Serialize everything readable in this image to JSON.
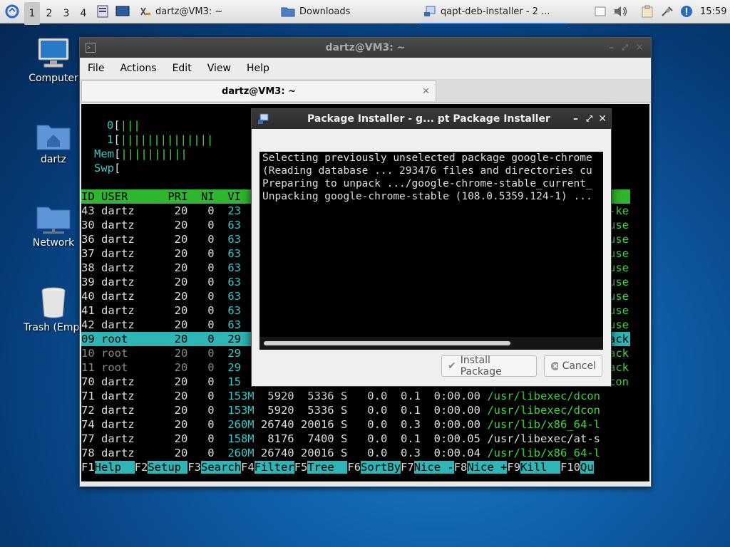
{
  "taskbar": {
    "workspaces": [
      "1",
      "2",
      "3",
      "4"
    ],
    "tasks": [
      {
        "label": "dartz@VM3: ~",
        "icon": "terminal-icon"
      },
      {
        "label": "Downloads",
        "icon": "folder-icon"
      },
      {
        "label": "qapt-deb-installer - 2 ...",
        "icon": "package-icon"
      }
    ],
    "clock": "15:59"
  },
  "desktop_icons": [
    {
      "label": "Computer",
      "icon": "computer-icon"
    },
    {
      "label": "dartz",
      "icon": "home-folder-icon"
    },
    {
      "label": "Network",
      "icon": "network-folder-icon"
    },
    {
      "label": "Trash (Empt",
      "icon": "trash-icon"
    }
  ],
  "terminal": {
    "title": "dartz@VM3: ~",
    "menu": [
      "File",
      "Actions",
      "Edit",
      "View",
      "Help"
    ],
    "tab_title": "dartz@VM3: ~",
    "meters": [
      {
        "label": "0",
        "bars": "|||"
      },
      {
        "label": "1",
        "bars": "||||||||||||||"
      },
      {
        "label": "Mem",
        "bars": "||||||||||"
      },
      {
        "label": "Swp",
        "bars": ""
      }
    ],
    "header": "ID USER      PRI  NI  VI",
    "header_right": "",
    "rows": [
      {
        "left": "43 dartz      20   0  ",
        "virt": "23",
        "right": "-ke"
      },
      {
        "left": "30 dartz      20   0  ",
        "virt": "63",
        "right": "use"
      },
      {
        "left": "36 dartz      20   0  ",
        "virt": "63",
        "right": "use"
      },
      {
        "left": "37 dartz      20   0  ",
        "virt": "63",
        "right": "use"
      },
      {
        "left": "38 dartz      20   0  ",
        "virt": "63",
        "right": "use"
      },
      {
        "left": "39 dartz      20   0  ",
        "virt": "63",
        "right": "use"
      },
      {
        "left": "40 dartz      20   0  ",
        "virt": "63",
        "right": "use"
      },
      {
        "left": "41 dartz      20   0  ",
        "virt": "63",
        "right": "use"
      },
      {
        "left": "42 dartz      20   0  ",
        "virt": "63",
        "right": "use"
      },
      {
        "left": "09 root       20   0  ",
        "virt": "29",
        "right": "ack"
      },
      {
        "left": "10 root       20   0  ",
        "virt": "29",
        "right": "ack"
      },
      {
        "left": "11 root       20   0  ",
        "virt": "29",
        "right": "ack"
      },
      {
        "left": "70 dartz      20   0  ",
        "virt": "15",
        "right": "con"
      }
    ],
    "full_rows": [
      {
        "head": "71 dartz      20   0  ",
        "virt": "153M",
        "res": "  5920",
        "shr": "  5336",
        "s": " S",
        "cpu": "   0.0",
        "mem": "  0.1",
        "time": "  0:00.00",
        "cmd": " /usr/libexec/dcon"
      },
      {
        "head": "72 dartz      20   0  ",
        "virt": "153M",
        "res": "  5920",
        "shr": "  5336",
        "s": " S",
        "cpu": "   0.0",
        "mem": "  0.1",
        "time": "  0:00.00",
        "cmd": " /usr/libexec/dcon"
      },
      {
        "head": "74 dartz      20   0  ",
        "virt": "260M",
        "res": " 26740",
        "shr": " 20016",
        "s": " S",
        "cpu": "   0.0",
        "mem": "  0.3",
        "time": "  0:00.00",
        "cmd": " /usr/lib/x86_64-l"
      },
      {
        "head": "77 dartz      20   0  ",
        "virt": "158M",
        "res": "  8176",
        "shr": "  7400",
        "s": " S",
        "cpu": "   0.0",
        "mem": "  0.1",
        "time": "  0:00.05",
        "cmd": " /usr/libexec/at-s"
      },
      {
        "head": "78 dartz      20   0  ",
        "virt": "260M",
        "res": " 26740",
        "shr": " 20016",
        "s": " S",
        "cpu": "   0.0",
        "mem": "  0.3",
        "time": "  0:00.04",
        "cmd": " /usr/lib/x86_64-l"
      }
    ],
    "fkeys": [
      {
        "key": "F1",
        "label": "Help  "
      },
      {
        "key": "F2",
        "label": "Setup "
      },
      {
        "key": "F3",
        "label": "Search"
      },
      {
        "key": "F4",
        "label": "Filter"
      },
      {
        "key": "F5",
        "label": "Tree  "
      },
      {
        "key": "F6",
        "label": "SortBy"
      },
      {
        "key": "F7",
        "label": "Nice -"
      },
      {
        "key": "F8",
        "label": "Nice +"
      },
      {
        "key": "F9",
        "label": "Kill  "
      },
      {
        "key": "F10",
        "label": "Qu"
      }
    ]
  },
  "dialog": {
    "title": "Package Installer - g...  pt Package Installer",
    "log": [
      "Selecting previously unselected package google-chrome",
      "(Reading database ... 293476 files and directories cu",
      "Preparing to unpack .../google-chrome-stable_current_",
      "Unpacking google-chrome-stable (108.0.5359.124-1) ..."
    ],
    "install_label": "Install Package",
    "cancel_label": "Cancel"
  }
}
